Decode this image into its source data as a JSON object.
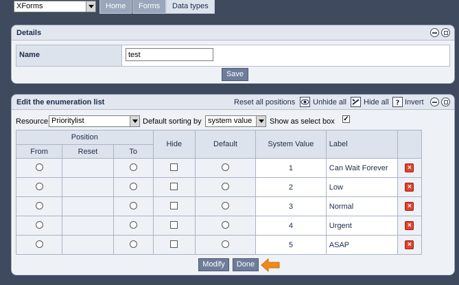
{
  "topbar": {
    "form_select_value": "XForms",
    "tabs": [
      {
        "label": "Home"
      },
      {
        "label": "Forms"
      },
      {
        "label": "Data types"
      }
    ]
  },
  "details": {
    "title": "Details",
    "name_label": "Name",
    "name_value": "test",
    "save_label": "Save"
  },
  "enum": {
    "title": "Edit the enumeration list",
    "reset_all_label": "Reset all positions",
    "unhide_all_label": "Unhide all",
    "hide_all_label": "Hide all",
    "invert_label": "Invert",
    "resource_label": "Resource",
    "resource_value": "Prioritylist",
    "default_sorting_label": "Default sorting by",
    "default_sorting_value": "system value",
    "show_as_select_label": "Show as select box",
    "columns": {
      "position": "Position",
      "from": "From",
      "reset": "Reset",
      "to": "To",
      "hide": "Hide",
      "default": "Default",
      "system_value": "System Value",
      "label": "Label"
    },
    "rows": [
      {
        "system_value": "1",
        "label": "Can Wait Forever"
      },
      {
        "system_value": "2",
        "label": "Low"
      },
      {
        "system_value": "3",
        "label": "Normal"
      },
      {
        "system_value": "4",
        "label": "Urgent"
      },
      {
        "system_value": "5",
        "label": "ASAP"
      }
    ],
    "modify_label": "Modify",
    "done_label": "Done"
  },
  "colors": {
    "background": "#3f4a5e",
    "panel": "#eef1f6",
    "button": "#6e7d99",
    "delete": "#e0432c",
    "arrow": "#f28a1a"
  }
}
